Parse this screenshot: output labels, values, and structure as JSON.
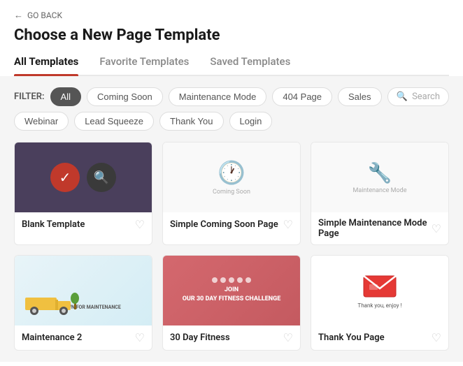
{
  "navigation": {
    "go_back_label": "GO BACK",
    "arrow": "←"
  },
  "header": {
    "title": "Choose a New Page Template"
  },
  "tabs": [
    {
      "id": "all",
      "label": "All Templates",
      "active": true
    },
    {
      "id": "favorite",
      "label": "Favorite Templates",
      "active": false
    },
    {
      "id": "saved",
      "label": "Saved Templates",
      "active": false
    }
  ],
  "filter": {
    "label": "FILTER:",
    "search_placeholder": "Search",
    "buttons": [
      {
        "id": "all",
        "label": "All",
        "active": true
      },
      {
        "id": "coming-soon",
        "label": "Coming Soon",
        "active": false
      },
      {
        "id": "maintenance",
        "label": "Maintenance Mode",
        "active": false
      },
      {
        "id": "404",
        "label": "404 Page",
        "active": false
      },
      {
        "id": "sales",
        "label": "Sales",
        "active": false
      },
      {
        "id": "webinar",
        "label": "Webinar",
        "active": false
      },
      {
        "id": "lead-squeeze",
        "label": "Lead Squeeze",
        "active": false
      },
      {
        "id": "thank-you",
        "label": "Thank You",
        "active": false
      },
      {
        "id": "login",
        "label": "Login",
        "active": false
      }
    ]
  },
  "templates": {
    "row1": [
      {
        "id": "blank",
        "name": "Blank Template",
        "type": "blank"
      },
      {
        "id": "coming-soon",
        "name": "Simple Coming Soon Page",
        "type": "coming-soon"
      },
      {
        "id": "maintenance",
        "name": "Simple Maintenance Mode Page",
        "type": "maintenance"
      }
    ],
    "row2": [
      {
        "id": "maintenance-2",
        "name": "Maintenance 2",
        "type": "truck"
      },
      {
        "id": "fitness",
        "name": "30 Day Fitness",
        "type": "fitness",
        "text": "JOIN\nOUR 30 DAY FITNESS CHALLENGE"
      },
      {
        "id": "thank-you",
        "name": "Thank You Page",
        "type": "thankyou",
        "text": "Thank you, enjoy !"
      }
    ]
  },
  "colors": {
    "accent_red": "#c0392b",
    "tab_underline": "#c0392b",
    "active_filter_bg": "#555555"
  },
  "icons": {
    "heart": "♡",
    "search": "🔍",
    "clock": "🕐",
    "wrench": "🔧",
    "check": "✓",
    "magnify": "🔍"
  }
}
